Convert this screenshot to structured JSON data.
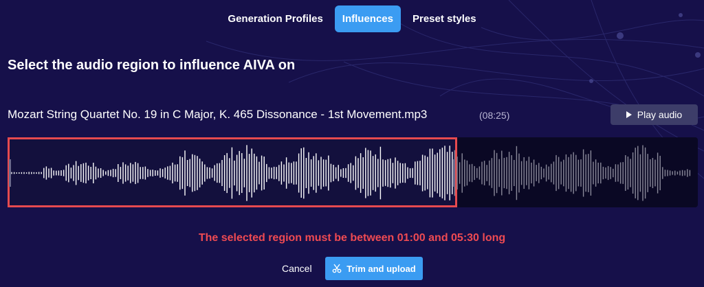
{
  "tabs": [
    {
      "label": "Generation Profiles",
      "active": false
    },
    {
      "label": "Influences",
      "active": true
    },
    {
      "label": "Preset styles",
      "active": false
    }
  ],
  "heading": "Select the audio region to influence AIVA on",
  "file": {
    "name": "Mozart String Quartet No. 19 in C Major, K. 465 Dissonance - 1st Movement.mp3",
    "duration": "(08:25)"
  },
  "play_button": {
    "label": "Play audio",
    "icon": "play-icon"
  },
  "waveform": {
    "selected_fraction": 0.65,
    "selected_color": "#ffffff",
    "unselected_color": "#8a8a9a",
    "selection_border_color": "#e64a4f"
  },
  "error_message": "The selected region must be between 01:00 and 05:30 long",
  "actions": {
    "cancel_label": "Cancel",
    "trim_label": "Trim and upload",
    "trim_icon": "scissors-icon"
  },
  "colors": {
    "background": "#16104a",
    "accent": "#3b9cf2",
    "error": "#ef4a52"
  }
}
